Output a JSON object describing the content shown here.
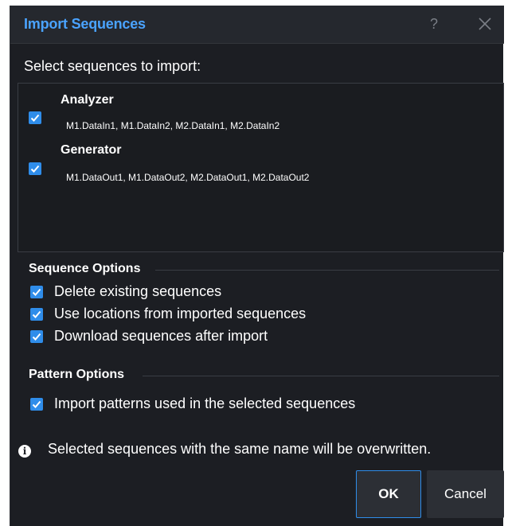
{
  "dialog": {
    "title": "Import Sequences",
    "help_label": "?",
    "prompt": "Select sequences to import:"
  },
  "sequences": [
    {
      "name": "Analyzer",
      "checked": true,
      "items": "M1.DataIn1, M1.DataIn2, M2.DataIn1, M2.DataIn2"
    },
    {
      "name": "Generator",
      "checked": true,
      "items": "M1.DataOut1, M1.DataOut2, M2.DataOut1, M2.DataOut2"
    }
  ],
  "sequence_options": {
    "heading": "Sequence Options",
    "options": [
      {
        "label": "Delete existing sequences",
        "checked": true
      },
      {
        "label": "Use locations from imported sequences",
        "checked": true
      },
      {
        "label": "Download sequences after import",
        "checked": true
      }
    ]
  },
  "pattern_options": {
    "heading": "Pattern Options",
    "options": [
      {
        "label": "Import patterns used in the selected sequences",
        "checked": true
      }
    ]
  },
  "info": {
    "icon": "info-icon",
    "text": "Selected sequences with the same name will be overwritten."
  },
  "buttons": {
    "ok_label": "OK",
    "cancel_label": "Cancel"
  },
  "colors": {
    "accent": "#2f8dea",
    "title": "#4aa3ff",
    "background": "#1c1e23"
  }
}
